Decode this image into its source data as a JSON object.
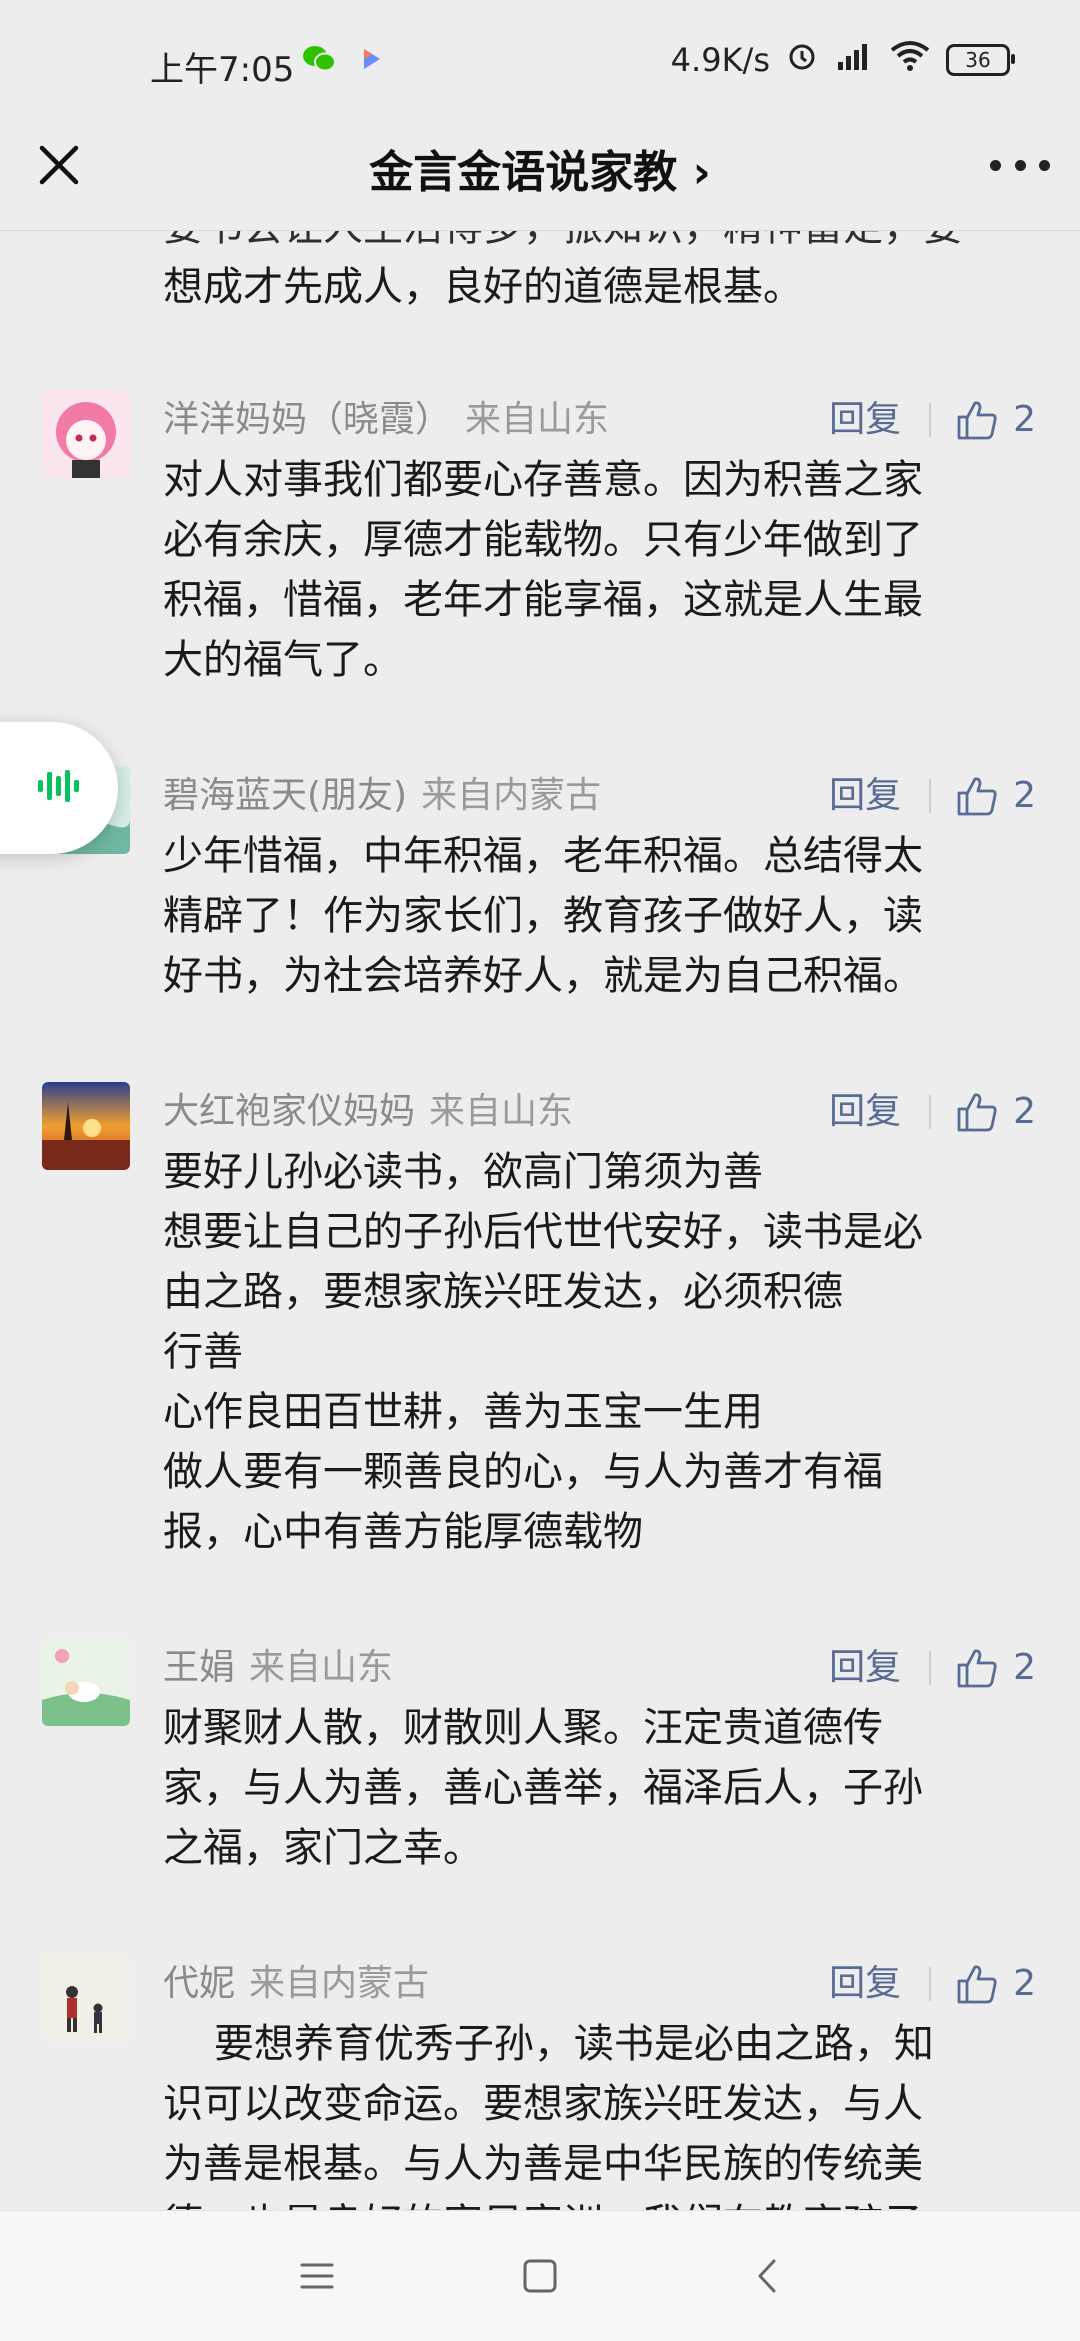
{
  "status_bar": {
    "time": "上午7:05",
    "speed": "4.9K/s",
    "battery": "36",
    "icons": [
      "wechat-icon",
      "video-app-icon",
      "alarm-icon",
      "signal-icon",
      "wifi-icon",
      "battery-icon"
    ]
  },
  "header": {
    "title": "金言金语说家教 ›",
    "close_icon": "close-icon",
    "more_icon": "more-icon"
  },
  "partial_top": {
    "line1": "要书会让人生活得多，振知识，精神富足，要",
    "line2": "想成才先成人，良好的道德是根基。"
  },
  "comments": [
    {
      "name": "洋洋妈妈（晓霞）",
      "location": "来自山东",
      "reply": "回复",
      "likes": "2",
      "text": "对人对事我们都要心存善意。因为积善之家\n必有余庆，厚德才能载物。只有少年做到了\n积福，惜福，老年才能享福，这就是人生最\n大的福气了。"
    },
    {
      "name": "碧海蓝天(朋友)",
      "location": "来自内蒙古",
      "reply": "回复",
      "likes": "2",
      "text": "少年惜福，中年积福，老年积福。总结得太\n精辟了！作为家长们，教育孩子做好人，读\n好书，为社会培养好人，就是为自己积福。"
    },
    {
      "name": "大红袍家仪妈妈",
      "location": "来自山东",
      "reply": "回复",
      "likes": "2",
      "text": "要好儿孙必读书，欲高门第须为善\n想要让自己的子孙后代世代安好，读书是必\n由之路，要想家族兴旺发达，必须积德\n行善\n心作良田百世耕，善为玉宝一生用\n做人要有一颗善良的心，与人为善才有福\n报，心中有善方能厚德载物"
    },
    {
      "name": "王娟",
      "location": "来自山东",
      "reply": "回复",
      "likes": "2",
      "text": "财聚财人散，财散则人聚。汪定贵道德传\n家，与人为善，善心善举，福泽后人，子孙\n之福，家门之幸。"
    },
    {
      "name": "代妮",
      "location": "来自内蒙古",
      "reply": "回复",
      "likes": "2",
      "text": "    要想养育优秀子孙，读书是必由之路，知\n识可以改变命运。要想家族兴旺发达，与人\n为善是根基。与人为善是中华民族的传统美\n德，也是良好的家风家训。我们在教育孩子"
    }
  ],
  "colors": {
    "background": "#ededed",
    "link": "#576b95",
    "meta": "#8a8a8a",
    "voice_green": "#07c160"
  },
  "navbar": {
    "icons": [
      "menu-icon",
      "home-icon",
      "back-icon"
    ]
  }
}
